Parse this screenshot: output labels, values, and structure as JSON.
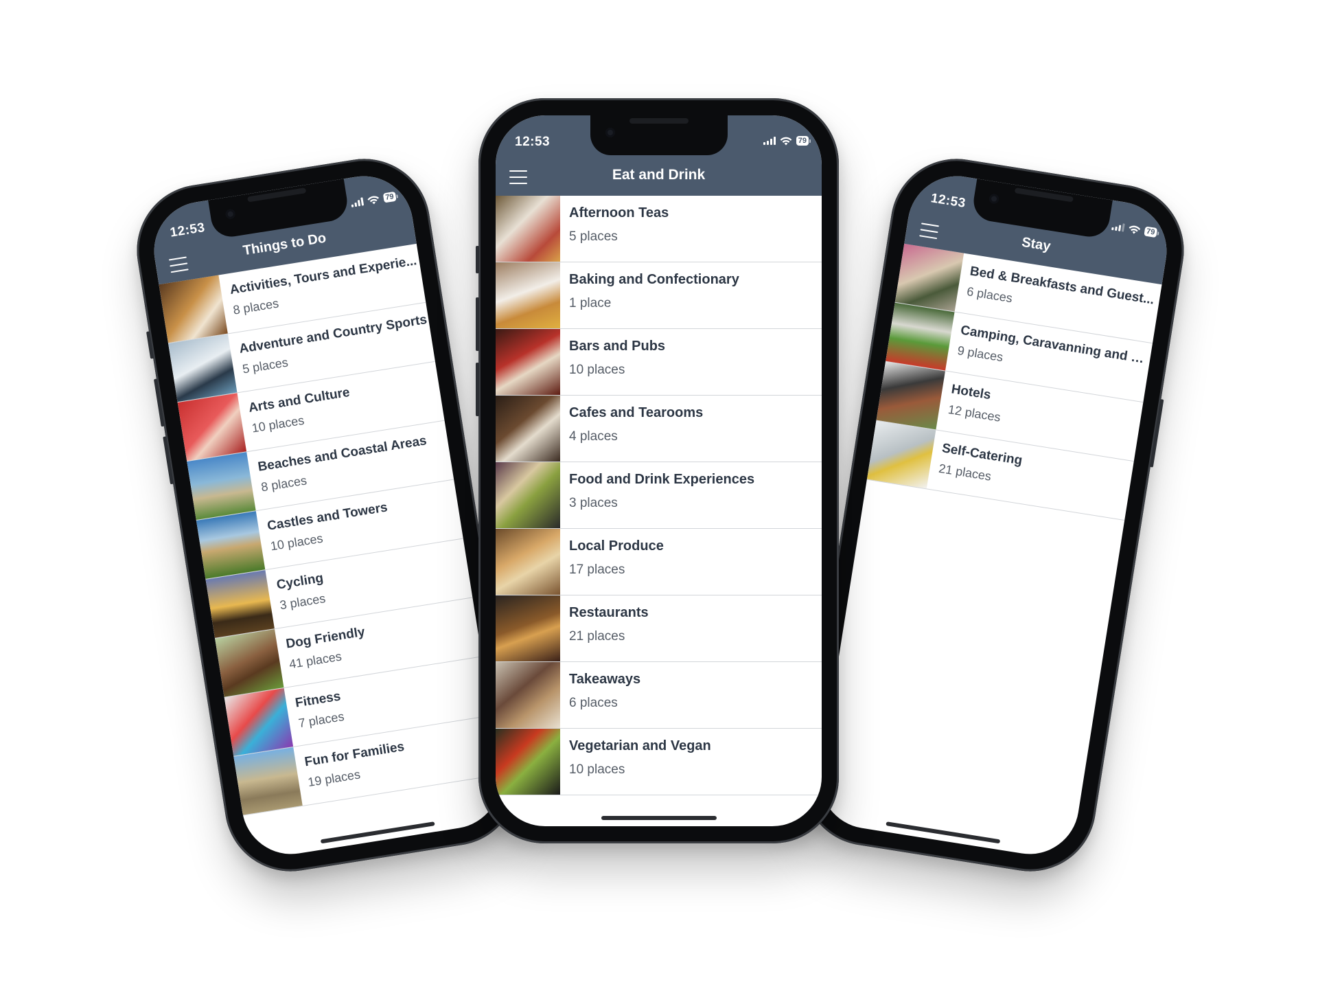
{
  "status_bar": {
    "time": "12:53",
    "battery": "79",
    "icons": [
      "signal-icon",
      "wifi-icon",
      "battery-icon"
    ]
  },
  "accent": {
    "header": "#4b5a6d",
    "title_text": "#2c3644",
    "count_text": "#555c66",
    "divider": "#d2d5d9"
  },
  "phones": {
    "left": {
      "title": "Things to Do",
      "items": [
        {
          "name": "Activities, Tours and Experie...",
          "count": "8 places"
        },
        {
          "name": "Adventure and Country Sports",
          "count": "5 places"
        },
        {
          "name": "Arts and Culture",
          "count": "10 places"
        },
        {
          "name": "Beaches and Coastal Areas",
          "count": "8 places"
        },
        {
          "name": "Castles and Towers",
          "count": "10 places"
        },
        {
          "name": "Cycling",
          "count": "3 places"
        },
        {
          "name": "Dog Friendly",
          "count": "41 places"
        },
        {
          "name": "Fitness",
          "count": "7 places"
        },
        {
          "name": "Fun for Families",
          "count": "19 places"
        }
      ]
    },
    "center": {
      "title": "Eat and Drink",
      "items": [
        {
          "name": "Afternoon Teas",
          "count": "5 places"
        },
        {
          "name": "Baking and Confectionary",
          "count": "1 place"
        },
        {
          "name": "Bars and Pubs",
          "count": "10 places"
        },
        {
          "name": "Cafes and Tearooms",
          "count": "4 places"
        },
        {
          "name": "Food and Drink Experiences",
          "count": "3 places"
        },
        {
          "name": "Local Produce",
          "count": "17 places"
        },
        {
          "name": "Restaurants",
          "count": "21 places"
        },
        {
          "name": "Takeaways",
          "count": "6 places"
        },
        {
          "name": "Vegetarian and Vegan",
          "count": "10 places"
        }
      ]
    },
    "right": {
      "title": "Stay",
      "items": [
        {
          "name": "Bed & Breakfasts and Guest...",
          "count": "6 places"
        },
        {
          "name": "Camping, Caravanning and G...",
          "count": "9 places"
        },
        {
          "name": "Hotels",
          "count": "12 places"
        },
        {
          "name": "Self-Catering",
          "count": "21 places"
        }
      ]
    }
  }
}
